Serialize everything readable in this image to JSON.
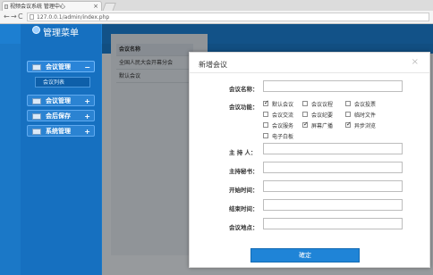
{
  "browser": {
    "tab_title": "视频会议系统 管理中心",
    "tab_close": "×",
    "nav_back": "←",
    "nav_forward": "→",
    "nav_refresh": "C",
    "url": "127.0.0.1/admin/index.php"
  },
  "sidebar": {
    "brand": "管理菜单",
    "menus": [
      {
        "label": "会议管理",
        "sign": "−"
      },
      {
        "label": "会议管理",
        "sign": "+"
      },
      {
        "label": "会后保存",
        "sign": "+"
      },
      {
        "label": "系统管理",
        "sign": "+"
      }
    ],
    "submenu": "会议列表"
  },
  "table": {
    "header": "会议名称",
    "rows": [
      "全国人民大会开幕分会",
      "默认会议"
    ]
  },
  "modal": {
    "title": "新增会议",
    "close": "×",
    "labels": {
      "name": "会议名称：",
      "functions": "会议功能：",
      "host": "主 持 人：",
      "secretary": "主持秘书：",
      "start": "开始时间：",
      "end": "结束时间：",
      "location": "会议地点："
    },
    "functions": [
      {
        "label": "默认会议",
        "checked": true
      },
      {
        "label": "会议议程",
        "checked": false
      },
      {
        "label": "会议投票",
        "checked": false
      },
      {
        "label": "会议交流",
        "checked": false
      },
      {
        "label": "会议纪要",
        "checked": false
      },
      {
        "label": "临时文件",
        "checked": false
      },
      {
        "label": "会议服务",
        "checked": false
      },
      {
        "label": "屏幕广播",
        "checked": true
      },
      {
        "label": "异步浏览",
        "checked": true
      },
      {
        "label": "电子白板",
        "checked": false
      }
    ],
    "submit": "確定"
  }
}
